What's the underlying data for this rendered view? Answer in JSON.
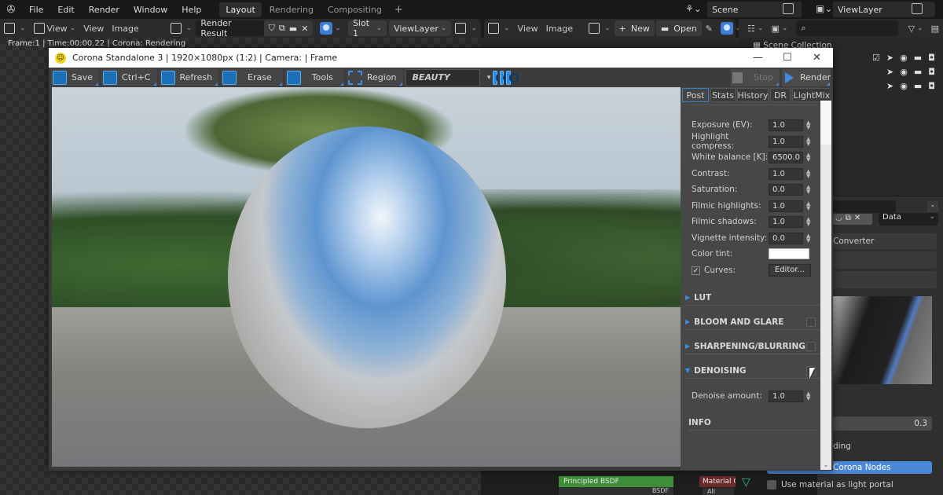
{
  "blender": {
    "menu": [
      "File",
      "Edit",
      "Render",
      "Window",
      "Help"
    ],
    "workspaces": [
      {
        "label": "Layout",
        "active": true
      },
      {
        "label": "Rendering",
        "active": false
      },
      {
        "label": "Compositing",
        "active": false
      }
    ],
    "add_workspace": "+",
    "scene": "Scene",
    "view_layer": "ViewLayer",
    "image_editor": {
      "view_menu": "View",
      "view": "View",
      "image": "Image",
      "image_name": "Render Result",
      "slot": "Slot 1",
      "layer": "ViewLayer"
    },
    "second_editor": {
      "view": "View",
      "image": "Image",
      "new": "New",
      "open": "Open"
    },
    "status_text": "Frame:1 | Time:00:00.22 | Corona: Rendering",
    "outliner": {
      "scene_collection": "Scene Collection"
    },
    "properties": {
      "data_select": "Data",
      "converter": "Converter",
      "value": "0.3",
      "section_partial": "ding",
      "corona_nodes": "Corona Nodes",
      "light_portal": "Use material as light portal"
    },
    "nodes": {
      "principled": "Principled BSDF",
      "bsdf_socket": "BSDF",
      "material_output": "Material C",
      "target": "All"
    }
  },
  "corona": {
    "title": "Corona Standalone 3 | 1920×1080px (1:2) | Camera:  | Frame",
    "window_controls": {
      "minimize": "—",
      "maximize": "☐",
      "close": "✕"
    },
    "toolbar": {
      "save": "Save",
      "copy": "Ctrl+C",
      "refresh": "Refresh",
      "erase": "Erase",
      "tools": "Tools",
      "region": "Region",
      "channel": "BEAUTY",
      "stop": "Stop",
      "render": "Render"
    },
    "tabs": [
      {
        "label": "Post",
        "active": true
      },
      {
        "label": "Stats",
        "active": false
      },
      {
        "label": "History",
        "active": false
      },
      {
        "label": "DR",
        "active": false
      },
      {
        "label": "LightMix",
        "active": false
      }
    ],
    "post": [
      {
        "label": "Exposure (EV):",
        "value": "1.0"
      },
      {
        "label": "Highlight compress:",
        "value": "1.0"
      },
      {
        "label": "White balance [K]:",
        "value": "6500.0"
      },
      {
        "label": "Contrast:",
        "value": "1.0"
      },
      {
        "label": "Saturation:",
        "value": "0.0"
      },
      {
        "label": "Filmic highlights:",
        "value": "1.0"
      },
      {
        "label": "Filmic shadows:",
        "value": "1.0"
      },
      {
        "label": "Vignette intensity:",
        "value": "0.0"
      }
    ],
    "color_tint_label": "Color tint:",
    "color_tint": "#ffffff",
    "curves_label": "Curves:",
    "curves_checked": true,
    "curves_button": "Editor...",
    "sections": [
      {
        "label": "LUT",
        "expanded": false,
        "checkbox": false
      },
      {
        "label": "BLOOM AND GLARE",
        "expanded": false,
        "checkbox": true
      },
      {
        "label": "SHARPENING/BLURRING",
        "expanded": false,
        "checkbox": true
      },
      {
        "label": "DENOISING",
        "expanded": true,
        "checkbox": true
      }
    ],
    "denoise_label": "Denoise amount:",
    "denoise_value": "1.0",
    "info_label": "INFO"
  },
  "colors": {
    "accent": "#3d8ee0",
    "blender_blue": "#4a87d6",
    "node_green": "#3f8f3a",
    "node_red": "#6b2b2b"
  }
}
